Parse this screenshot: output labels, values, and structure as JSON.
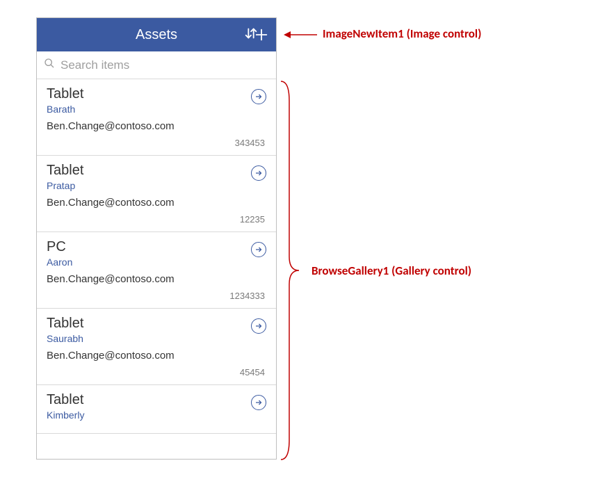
{
  "header": {
    "title": "Assets"
  },
  "search": {
    "placeholder": "Search items"
  },
  "items": [
    {
      "title": "Tablet",
      "sub": "Barath",
      "email": "Ben.Change@contoso.com",
      "id": "343453"
    },
    {
      "title": "Tablet",
      "sub": "Pratap",
      "email": "Ben.Change@contoso.com",
      "id": "12235"
    },
    {
      "title": "PC",
      "sub": "Aaron",
      "email": "Ben.Change@contoso.com",
      "id": "1234333"
    },
    {
      "title": "Tablet",
      "sub": "Saurabh",
      "email": "Ben.Change@contoso.com",
      "id": "45454"
    },
    {
      "title": "Tablet",
      "sub": "Kimberly",
      "email": "",
      "id": ""
    }
  ],
  "annotations": {
    "top": "ImageNewItem1 (Image control)",
    "middle": "BrowseGallery1 (Gallery control)"
  }
}
